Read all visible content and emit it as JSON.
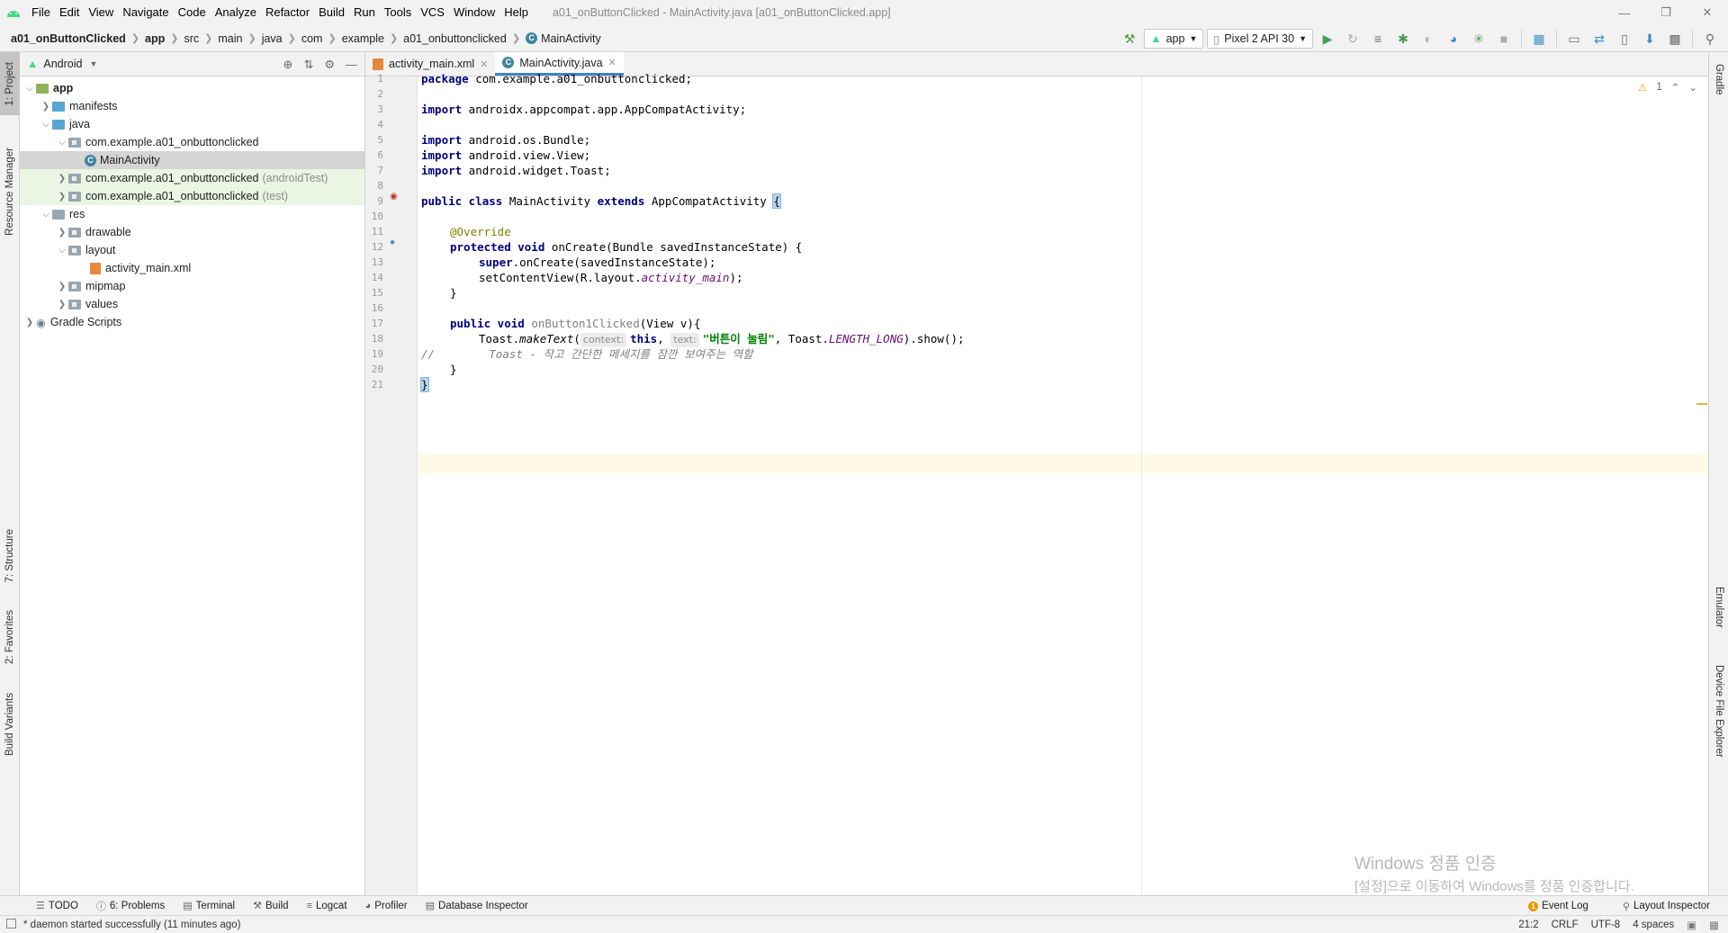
{
  "menubar": {
    "items": [
      "File",
      "Edit",
      "View",
      "Navigate",
      "Code",
      "Analyze",
      "Refactor",
      "Build",
      "Run",
      "Tools",
      "VCS",
      "Window",
      "Help"
    ],
    "window_title": "a01_onButtonClicked - MainActivity.java [a01_onButtonClicked.app]"
  },
  "breadcrumb": [
    "a01_onButtonClicked",
    "app",
    "src",
    "main",
    "java",
    "com",
    "example",
    "a01_onbuttonclicked",
    "MainActivity"
  ],
  "toolbar": {
    "run_config": "app",
    "device": "Pixel 2 API 30"
  },
  "left_strip": [
    "1: Project",
    "Resource Manager",
    "7: Structure",
    "2: Favorites",
    "Build Variants"
  ],
  "right_strip": [
    "Gradle",
    "Emulator",
    "Device File Explorer"
  ],
  "project_panel": {
    "view_mode": "Android",
    "tree": [
      {
        "label": "app",
        "suffix": ""
      },
      {
        "label": "manifests",
        "suffix": ""
      },
      {
        "label": "java",
        "suffix": ""
      },
      {
        "label": "com.example.a01_onbuttonclicked",
        "suffix": ""
      },
      {
        "label": "MainActivity",
        "suffix": ""
      },
      {
        "label": "com.example.a01_onbuttonclicked",
        "suffix": "(androidTest)"
      },
      {
        "label": "com.example.a01_onbuttonclicked",
        "suffix": "(test)"
      },
      {
        "label": "res",
        "suffix": ""
      },
      {
        "label": "drawable",
        "suffix": ""
      },
      {
        "label": "layout",
        "suffix": ""
      },
      {
        "label": "activity_main.xml",
        "suffix": ""
      },
      {
        "label": "mipmap",
        "suffix": ""
      },
      {
        "label": "values",
        "suffix": ""
      },
      {
        "label": "Gradle Scripts",
        "suffix": ""
      }
    ]
  },
  "editor": {
    "tabs": [
      "activity_main.xml",
      "MainActivity.java"
    ],
    "line_numbers": [
      "1",
      "2",
      "3",
      "4",
      "5",
      "6",
      "7",
      "8",
      "9",
      "10",
      "11",
      "12",
      "13",
      "14",
      "15",
      "16",
      "17",
      "18",
      "19",
      "20",
      "21"
    ],
    "code": {
      "l1_kw": "package",
      "l1": " com.example.a01_onbuttonclicked;",
      "l3_kw": "import",
      "l3": " androidx.appcompat.app.AppCompatActivity;",
      "l5_kw": "import",
      "l5": " android.os.Bundle;",
      "l6_kw": "import",
      "l6": " android.view.View;",
      "l7_kw": "import",
      "l7": " android.widget.Toast;",
      "l9_kw1": "public class",
      "l9_a": " MainActivity ",
      "l9_kw2": "extends",
      "l9_b": " AppCompatActivity ",
      "l9_brace": "{",
      "l11_ann": "@Override",
      "l12_kw": "protected void",
      "l12": " onCreate(Bundle savedInstanceState) {",
      "l13_kw": "super",
      "l13": ".onCreate(savedInstanceState);",
      "l14_a": "setContentView(R.layout.",
      "l14_it": "activity_main",
      "l14_b": ");",
      "l15": "}",
      "l17_kw": "public void",
      "l17_m": " onButton1Clicked",
      "l17": "(View v){",
      "l18_a": "Toast.",
      "l18_it": "makeText",
      "l18_b": "(",
      "l18_hint1": "context:",
      "l18_kw": "this",
      "l18_c": ", ",
      "l18_hint2": "text:",
      "l18_str": "\"버튼이 눌림\"",
      "l18_d": ", Toast.",
      "l18_const": "LENGTH_LONG",
      "l18_e": ").show();",
      "l19_slash": "//",
      "l19": "        Toast - 작고 간단한 메세지를 잠깐 보여주는 역할",
      "l20": "}",
      "l21": "}"
    },
    "warning_count": "1"
  },
  "watermark": {
    "line1": "Windows 정품 인증",
    "line2": "[설정]으로 이동하여 Windows를 정품 인증합니다."
  },
  "bottom_tools": [
    "TODO",
    "6: Problems",
    "Terminal",
    "Build",
    "Logcat",
    "Profiler",
    "Database Inspector"
  ],
  "bottom_right": [
    "Event Log",
    "Layout Inspector"
  ],
  "status": {
    "message": "* daemon started successfully (11 minutes ago)",
    "position": "21:2",
    "line_sep": "CRLF",
    "encoding": "UTF-8",
    "indent": "4 spaces"
  },
  "colors": {
    "keyword": "#000080",
    "string": "#008000",
    "annotation": "#808000",
    "caret_line": "#fffae3",
    "accent": "#4083c9"
  }
}
